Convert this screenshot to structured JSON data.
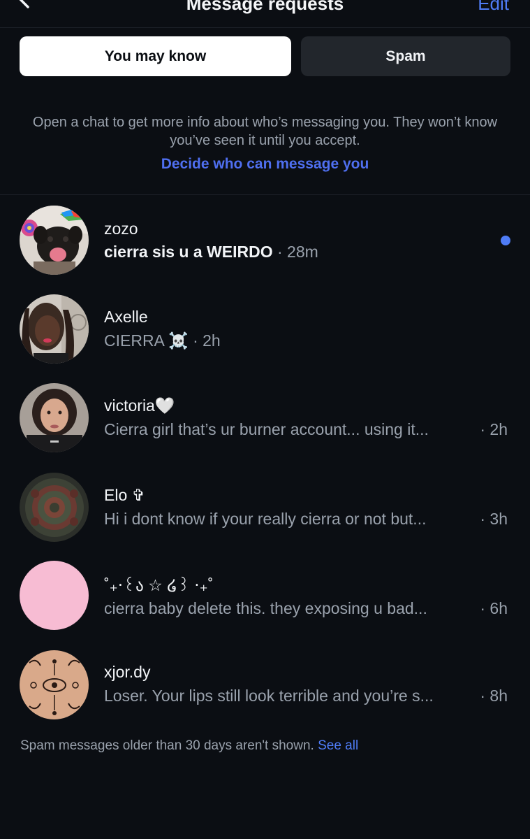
{
  "header": {
    "title": "Message requests",
    "edit_label": "Edit"
  },
  "tabs": [
    {
      "label": "You may know",
      "active": true
    },
    {
      "label": "Spam",
      "active": false
    }
  ],
  "info": {
    "text": "Open a chat to get more info about who’s messaging you. They won’t know you’ve seen it until you accept.",
    "link": "Decide who can message you"
  },
  "requests": [
    {
      "name": "zozo",
      "preview": "cierra sis u a WEIRDO",
      "time": "· 28m",
      "unread": true
    },
    {
      "name": "Axelle",
      "preview": "CIERRA ☠️",
      "time": "· 2h",
      "unread": false
    },
    {
      "name": "victoria🤍",
      "preview": "Cierra girl that’s ur burner account... using it...",
      "time": "· 2h",
      "unread": false
    },
    {
      "name": "Elo ✞",
      "preview": "Hi i dont know if your really cierra or not but...",
      "time": "· 3h",
      "unread": false
    },
    {
      "name": "˚₊‧꒰ა ☆ ໒꒱ ‧₊˚",
      "preview": "cierra baby delete this. they exposing u bad...",
      "time": "· 6h",
      "unread": false
    },
    {
      "name": "xjor.dy",
      "preview": "Loser. Your lips still look terrible and you’re s...",
      "time": "· 8h",
      "unread": false
    }
  ],
  "footer": {
    "text": "Spam messages older than 30 days aren't shown.",
    "link": "See all"
  },
  "colors": {
    "background": "#0b0e13",
    "accent": "#4f7cf6",
    "link": "#4f6ff0",
    "muted_text": "#9aa2ad",
    "tab_active": "#ffffff",
    "tab_inactive": "#22262c",
    "pink_avatar": "#f7bcd3"
  }
}
